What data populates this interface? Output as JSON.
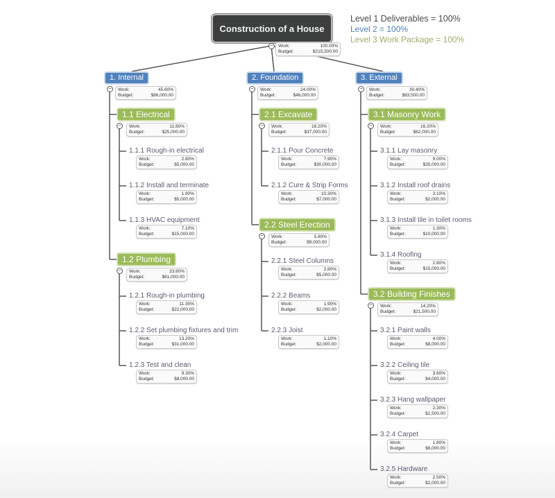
{
  "root": {
    "title": "Construction of a House",
    "work": "100.00%",
    "budget": "$215,500.00"
  },
  "legend": {
    "level1": "Level 1 Deliverables = 100%",
    "level2": "Level 2 = 100%",
    "level3": "Level 3 Work Package = 100%"
  },
  "labels": {
    "work": "Work:",
    "budget": "Budget:"
  },
  "colors": {
    "root": "#3d3f3f",
    "level1": "#4f81bd",
    "level2": "#9bbb59",
    "level3_text": "#5a5a72"
  },
  "branches": [
    {
      "title": "1.  Internal",
      "work": "45.60%",
      "budget": "$86,000.00",
      "children": [
        {
          "title": "1.1  Electrical",
          "work": "11.80%",
          "budget": "$25,000.00",
          "tasks": [
            {
              "title": "1.1.1  Rough-in electrical",
              "work": "2.80%",
              "budget": "$5,000.00"
            },
            {
              "title": "1.1.2  Install and terminate",
              "work": "1.90%",
              "budget": "$5,000.00"
            },
            {
              "title": "1.1.3  HVAC equipment",
              "work": "7.10%",
              "budget": "$15,000.00"
            }
          ]
        },
        {
          "title": "1.2  Plumbing",
          "work": "33.80%",
          "budget": "$61,000.00",
          "tasks": [
            {
              "title": "1.2.1  Rough-in plumbing",
              "work": "11.30%",
              "budget": "$22,000.00"
            },
            {
              "title": "1.2.2  Set plumbing fixtures and trim",
              "work": "13.20%",
              "budget": "$31,000.00"
            },
            {
              "title": "1.2.3  Test and clean",
              "work": "9.30%",
              "budget": "$8,000.00"
            }
          ]
        }
      ]
    },
    {
      "title": "2.  Foundation",
      "work": "24.00%",
      "budget": "$46,000.00",
      "children": [
        {
          "title": "2.1  Excavate",
          "work": "18.20%",
          "budget": "$37,000.00",
          "tasks": [
            {
              "title": "2.1.1  Pour Concrete",
              "work": "7.90%",
              "budget": "$30,000.00"
            },
            {
              "title": "2.1.2  Cure & Strip Forms",
              "work": "10.30%",
              "budget": "$7,000.00"
            }
          ]
        },
        {
          "title": "2.2  Steel Erection",
          "work": "5.80%",
          "budget": "$9,000.00",
          "tasks": [
            {
              "title": "2.2.1  Steel Columns",
              "work": "2.80%",
              "budget": "$5,000.00"
            },
            {
              "title": "2.2.2  Beams",
              "work": "1.90%",
              "budget": "$2,000.00"
            },
            {
              "title": "2.2.3  Joist",
              "work": "1.10%",
              "budget": "$2,000.00"
            }
          ]
        }
      ]
    },
    {
      "title": "3.  External",
      "work": "30.40%",
      "budget": "$83,500.00",
      "children": [
        {
          "title": "3.1  Masonry Work",
          "work": "16.20%",
          "budget": "$62,000.00",
          "tasks": [
            {
              "title": "3.1.1  Lay masonry",
              "work": "9.00%",
              "budget": "$35,000.00"
            },
            {
              "title": "3.1.2  Install roof drains",
              "work": "3.10%",
              "budget": "$2,000.00"
            },
            {
              "title": "3.1.3  Install tile in toilet rooms",
              "work": "1.30%",
              "budget": "$10,000.00"
            },
            {
              "title": "3.1.4  Roofing",
              "work": "2.80%",
              "budget": "$15,000.00"
            }
          ]
        },
        {
          "title": "3.2  Building Finishes",
          "work": "14.20%",
          "budget": "$21,500.00",
          "tasks": [
            {
              "title": "3.2.1  Paint walls",
              "work": "4.00%",
              "budget": "$8,000.00"
            },
            {
              "title": "3.2.2  Ceiling tile",
              "work": "3.60%",
              "budget": "$4,000.00"
            },
            {
              "title": "3.2.3  Hang wallpaper",
              "work": "2.30%",
              "budget": "$1,500.00"
            },
            {
              "title": "3.2.4  Carpet",
              "work": "1.80%",
              "budget": "$6,000.00"
            },
            {
              "title": "3.2.5  Hardware",
              "work": "2.50%",
              "budget": "$2,000.00"
            }
          ]
        }
      ]
    }
  ]
}
